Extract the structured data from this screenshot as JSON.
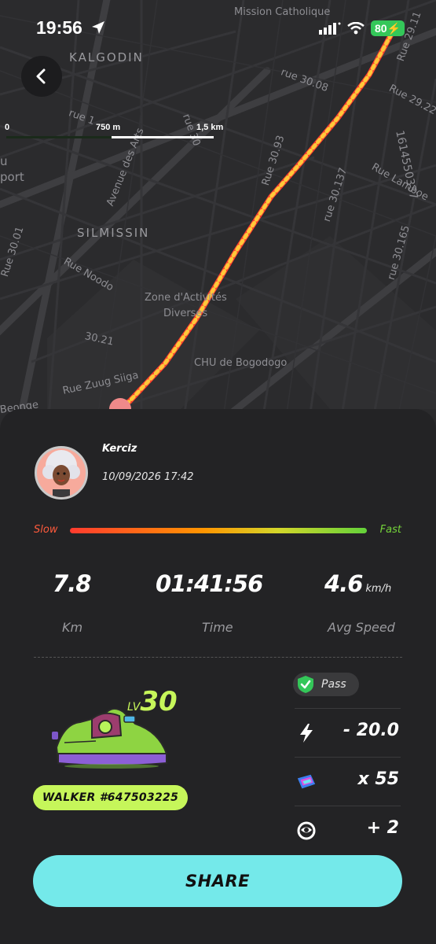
{
  "status_bar": {
    "time": "19:56",
    "battery": "80"
  },
  "map": {
    "labels": [
      {
        "id": "mission",
        "text": "Mission Catholique"
      },
      {
        "id": "kalgodin",
        "text": "KALGODIN"
      },
      {
        "id": "rue3008",
        "text": "rue 30.08"
      },
      {
        "id": "rue2922",
        "text": "Rue 29.22"
      },
      {
        "id": "rue2911",
        "text": "Rue 29.11"
      },
      {
        "id": "rue1",
        "text": "rue 1"
      },
      {
        "id": "avenue",
        "text": "Avenue des Arts"
      },
      {
        "id": "rue30",
        "text": "rue 30"
      },
      {
        "id": "rue3093",
        "text": "Rue 30.93"
      },
      {
        "id": "rue30137",
        "text": "rue 30.137"
      },
      {
        "id": "ruelamboe",
        "text": "Rue Lamboe"
      },
      {
        "id": "num",
        "text": "1614550337"
      },
      {
        "id": "airport1",
        "text": "u"
      },
      {
        "id": "airport2",
        "text": "port"
      },
      {
        "id": "silmissin",
        "text": "SILMISSIN"
      },
      {
        "id": "rue3001",
        "text": "Rue 30.01"
      },
      {
        "id": "ruenoodo",
        "text": "Rue Noodo"
      },
      {
        "id": "rue30165",
        "text": "rue 30.165"
      },
      {
        "id": "zone1",
        "text": "Zone d'Activités"
      },
      {
        "id": "zone2",
        "text": "Diverses"
      },
      {
        "id": "r3021",
        "text": "30.21"
      },
      {
        "id": "chu",
        "text": "CHU de Bogodogo"
      },
      {
        "id": "zuug",
        "text": "Rue Zuug Siiga"
      },
      {
        "id": "beonge",
        "text": "Beonge"
      }
    ],
    "scale": {
      "zero": "0",
      "mid": "750 m",
      "end": "1,5 km"
    }
  },
  "profile": {
    "username": "Kerciz",
    "datetime": "10/09/2026 17:42"
  },
  "speed_scale": {
    "slow": "Slow",
    "fast": "Fast"
  },
  "stats": {
    "distance": {
      "value": "7.8",
      "caption": "Km"
    },
    "time": {
      "value": "01:41:56",
      "caption": "Time"
    },
    "speed": {
      "value": "4.6",
      "unit": "km/h",
      "caption": "Avg Speed"
    }
  },
  "sneaker": {
    "level_prefix": "LV",
    "level": "30",
    "name": "WALKER #647503225"
  },
  "pass": {
    "label": "Pass"
  },
  "rewards": [
    {
      "icon": "lightning-icon",
      "value": "- 20.0"
    },
    {
      "icon": "ticket-icon",
      "value": "x 55"
    },
    {
      "icon": "badge-icon",
      "value": "+ 2"
    }
  ],
  "share_label": "SHARE",
  "colors": {
    "accent": "#74e9ea",
    "lime": "#c6f65a",
    "route_red": "#ff3b2f",
    "route_yellow": "#ffc83a"
  }
}
